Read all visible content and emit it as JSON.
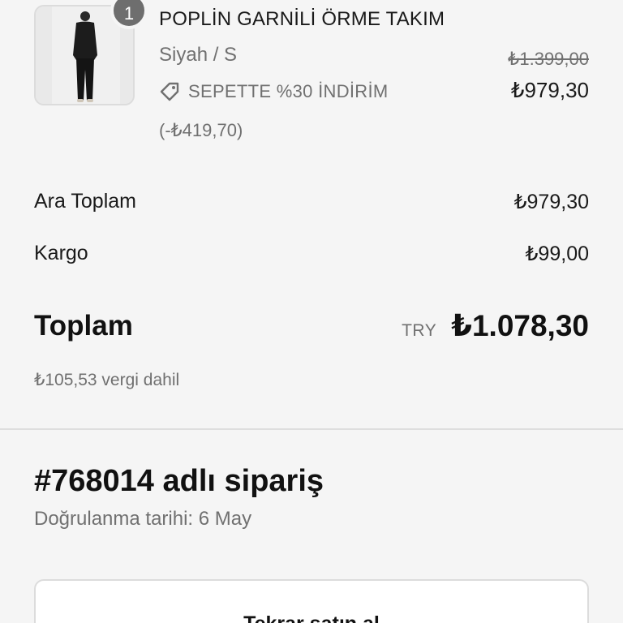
{
  "product": {
    "quantity": "1",
    "title": "POPLİN GARNİLİ ÖRME TAKIM",
    "variant": "Siyah / S",
    "discount_label": "SEPETTE %30 İNDİRİM",
    "discount_amount": "(-₺419,70)",
    "price_original": "₺1.399,00",
    "price_final": "₺979,30",
    "image_icon": "product-photo"
  },
  "summary": {
    "subtotal_label": "Ara Toplam",
    "subtotal_value": "₺979,30",
    "shipping_label": "Kargo",
    "shipping_value": "₺99,00",
    "total_label": "Toplam",
    "total_currency": "TRY",
    "total_value": "₺1.078,30",
    "tax_note": "₺105,53 vergi dahil"
  },
  "order": {
    "title": "#768014 adlı sipariş",
    "confirmed": "Doğrulanma tarihi: 6 May",
    "buy_again_label": "Tekrar satın al"
  },
  "colors": {
    "background": "#f5f5f5",
    "muted_text": "#707070",
    "badge": "#6e6e6e"
  }
}
